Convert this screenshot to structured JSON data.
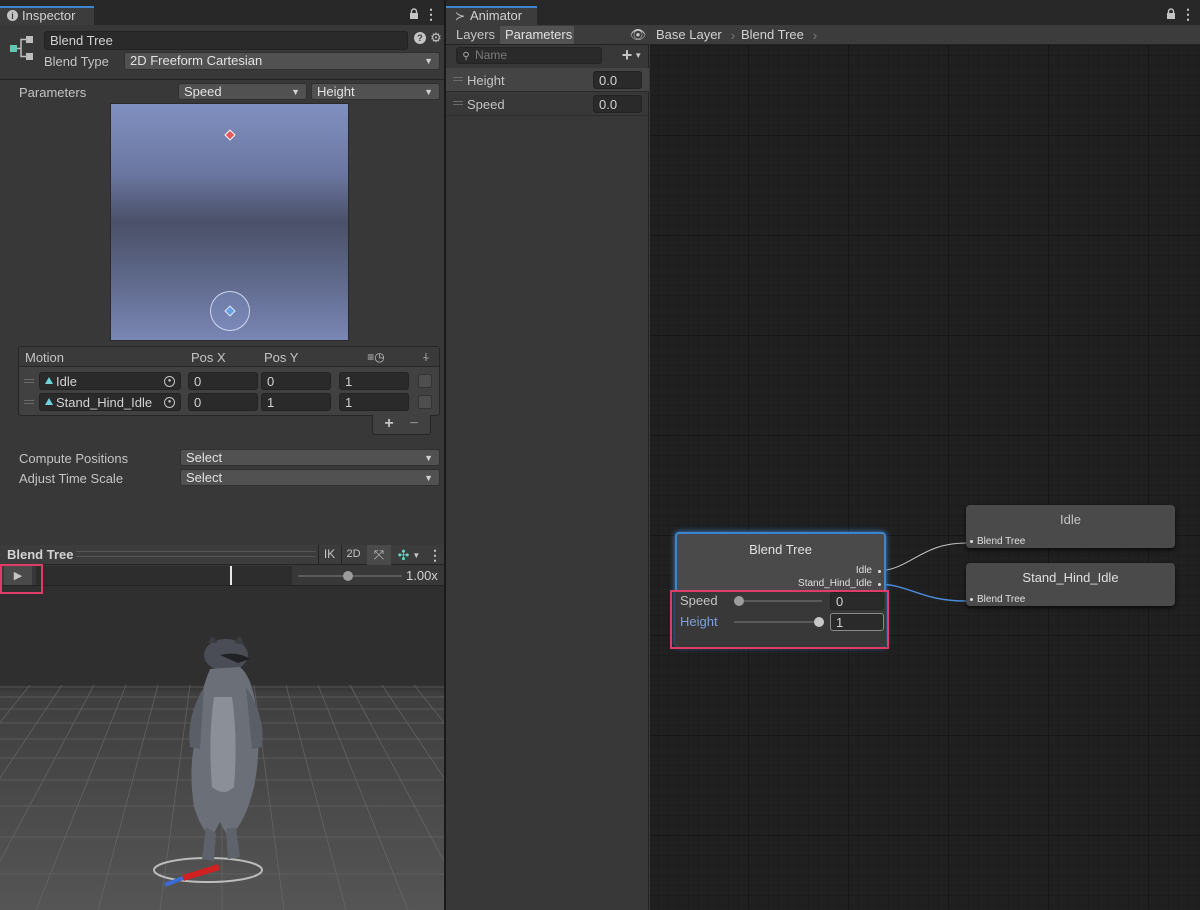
{
  "inspector": {
    "tab_label": "Inspector",
    "object_name": "Blend Tree",
    "blend_type_label": "Blend Type",
    "blend_type_value": "2D Freeform Cartesian",
    "parameters_label": "Parameters",
    "param_x": "Speed",
    "param_y": "Height",
    "motion_header": {
      "motion": "Motion",
      "pos_x": "Pos X",
      "pos_y": "Pos Y"
    },
    "motions": [
      {
        "name": "Idle",
        "pos_x": "0",
        "pos_y": "0",
        "speed": "1"
      },
      {
        "name": "Stand_Hind_Idle",
        "pos_x": "0",
        "pos_y": "1",
        "speed": "1"
      }
    ],
    "compute_positions_label": "Compute Positions",
    "compute_positions_value": "Select",
    "adjust_time_scale_label": "Adjust Time Scale",
    "adjust_time_scale_value": "Select"
  },
  "preview": {
    "title": "Blend Tree",
    "ik_label": "IK",
    "mode_label": "2D",
    "speed_value": "1.00x"
  },
  "animator": {
    "tab_label": "Animator",
    "tabs": [
      "Layers",
      "Parameters"
    ],
    "search_placeholder": "Name",
    "parameters": [
      {
        "name": "Height",
        "value": "0.0"
      },
      {
        "name": "Speed",
        "value": "0.0"
      }
    ],
    "breadcrumbs": [
      "Base Layer",
      "Blend Tree"
    ]
  },
  "graph": {
    "blend_node": {
      "title": "Blend Tree",
      "outputs": [
        "Idle",
        "Stand_Hind_Idle"
      ],
      "params": [
        {
          "name": "Speed",
          "value": "0",
          "slider": 0.0
        },
        {
          "name": "Height",
          "value": "1",
          "slider": 1.0
        }
      ]
    },
    "motion_nodes": [
      {
        "title": "Idle",
        "input": "Blend Tree"
      },
      {
        "title": "Stand_Hind_Idle",
        "input": "Blend Tree"
      }
    ]
  },
  "colors": {
    "highlight": "#e03c6a",
    "selection": "#3d86cf",
    "accent_label": "#7d9fe0"
  }
}
